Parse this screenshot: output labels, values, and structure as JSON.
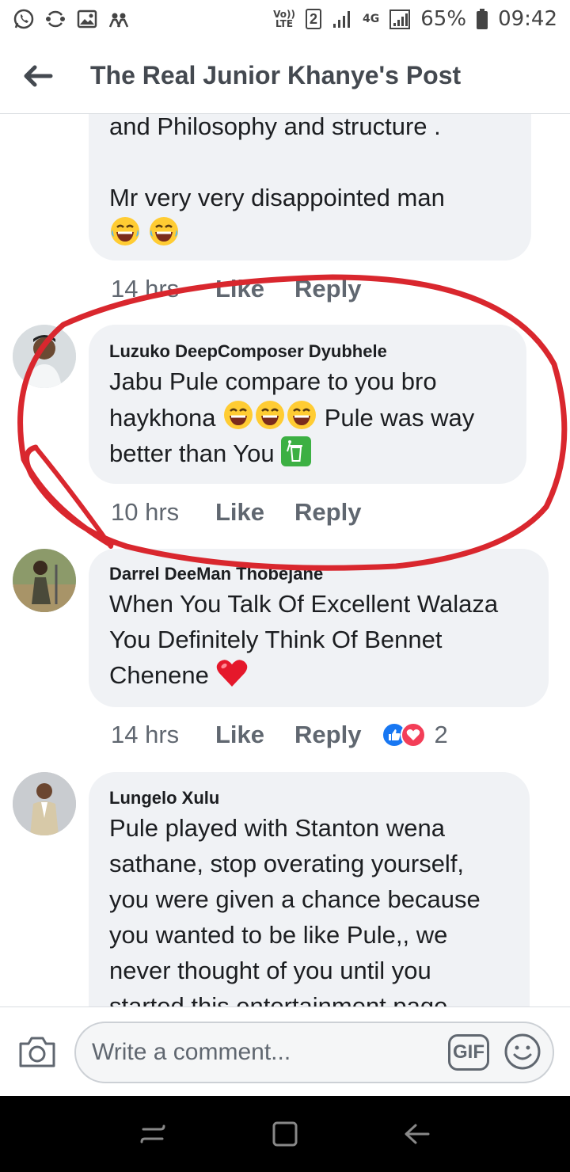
{
  "status_bar": {
    "network_label": "Vo)) LTE",
    "sim_label": "2",
    "net_type": "4G",
    "battery": "65%",
    "time": "09:42"
  },
  "header": {
    "title": "The Real Junior Khanye's Post"
  },
  "comments": [
    {
      "author": "",
      "lines": [
        "and Philosophy and  structure  .",
        "",
        "Mr very very disappointed man"
      ],
      "emojis": [
        "joy",
        "joy"
      ],
      "time": "14 hrs",
      "like": "Like",
      "reply": "Reply"
    },
    {
      "author": "Luzuko DeepComposer Dyubhele",
      "line1": "Jabu Pule compare to you bro",
      "line2a": "haykhona",
      "line2b": "Pule was way",
      "line3": "better than You",
      "time": "10 hrs",
      "like": "Like",
      "reply": "Reply"
    },
    {
      "author": "Darrel DeeMan Thobejane",
      "line1": "When You Talk Of Excellent Walaza",
      "line2": "You Definitely Think Of Bennet",
      "line3": "Chenene",
      "time": "14 hrs",
      "like": "Like",
      "reply": "Reply",
      "reaction_count": "2"
    },
    {
      "author": "Lungelo Xulu",
      "lines": [
        "Pule played with Stanton wena",
        "sathane, stop overating yourself,",
        "you were given a chance because",
        "you wanted to be like Pule,,  we",
        "never thought of you until you",
        "started this entertainment page"
      ]
    }
  ],
  "composer": {
    "placeholder": "Write a comment...",
    "gif_label": "GIF"
  },
  "colors": {
    "bubble": "#f0f2f5",
    "annotation_red": "#d9272e",
    "like_blue": "#1877f2",
    "love_red": "#f33e58"
  }
}
